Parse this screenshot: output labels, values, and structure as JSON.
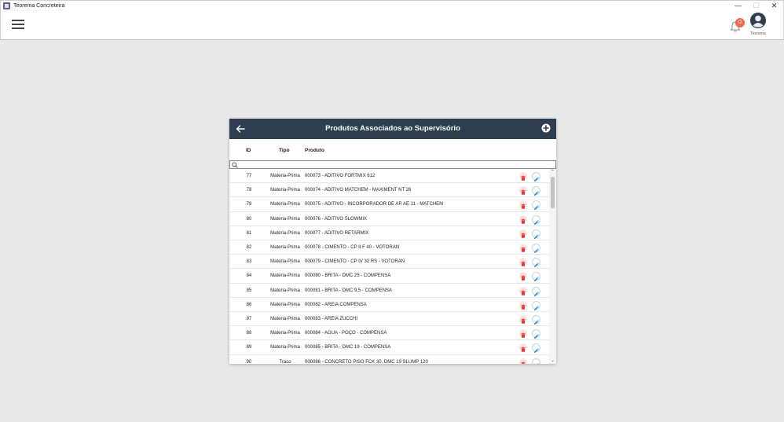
{
  "window": {
    "title": "Teorema Concreteira",
    "controls": {
      "minimize": "—",
      "maximize": "☐",
      "close": "✕"
    }
  },
  "appbar": {
    "notification_count": "0",
    "user_name": "Teorema"
  },
  "panel": {
    "title": "Produtos Associados ao Supervisório",
    "columns": {
      "id": "ID",
      "tipo": "Tipo",
      "produto": "Produto"
    },
    "search_placeholder": "",
    "rows": [
      {
        "id": "77",
        "tipo": "Materia-Prima",
        "produto": "000073 - ADITIVO FORTMIX 612"
      },
      {
        "id": "78",
        "tipo": "Materia-Prima",
        "produto": "000074 - ADITIVO MATCHEM - MAXIMENT NT 26"
      },
      {
        "id": "79",
        "tipo": "Materia-Prima",
        "produto": "000075 - ADITIVO - INCORPORADOR DE AR AE 11 - MATCHEM"
      },
      {
        "id": "80",
        "tipo": "Materia-Prima",
        "produto": "000076 - ADITIVO SLOWMIX"
      },
      {
        "id": "81",
        "tipo": "Materia-Prima",
        "produto": "000077 - ADITIVO RETARMIX"
      },
      {
        "id": "82",
        "tipo": "Materia-Prima",
        "produto": "000078 - CIMENTO - CP II F 40 - VOTORAN"
      },
      {
        "id": "83",
        "tipo": "Materia-Prima",
        "produto": "000079 - CIMENTO - CP IV 32 RS - VOTORAN"
      },
      {
        "id": "84",
        "tipo": "Materia-Prima",
        "produto": "000080 - BRITA - DMC 25 - COMPENSA"
      },
      {
        "id": "85",
        "tipo": "Materia-Prima",
        "produto": "000081 - BRITA - DMC 9,5 - COMPENSA"
      },
      {
        "id": "86",
        "tipo": "Materia-Prima",
        "produto": "000082 - AREIA COMPENSA"
      },
      {
        "id": "87",
        "tipo": "Materia-Prima",
        "produto": "000083 - AREIA ZUCCHI"
      },
      {
        "id": "88",
        "tipo": "Materia-Prima",
        "produto": "000084 - AGUA - POÇO - COMPENSA"
      },
      {
        "id": "89",
        "tipo": "Materia-Prima",
        "produto": "000085 - BRITA - DMC 19 - COMPENSA"
      },
      {
        "id": "90",
        "tipo": "Traco",
        "produto": "000086 - CONCRETO PISO FCK 30, DMC 19 SLUMP 120"
      }
    ]
  },
  "icons": {
    "menu": "hamburger-menu-icon",
    "notifications": "bell-icon",
    "avatar": "user-avatar-icon",
    "back": "arrow-left-icon",
    "add": "plus-circle-icon",
    "search": "search-icon",
    "delete": "trash-icon",
    "edit": "pencil-icon"
  },
  "colors": {
    "header_bg": "#2e3d50",
    "badge": "#ef6a4f",
    "delete": "#e53935",
    "edit": "#1e88e5"
  }
}
